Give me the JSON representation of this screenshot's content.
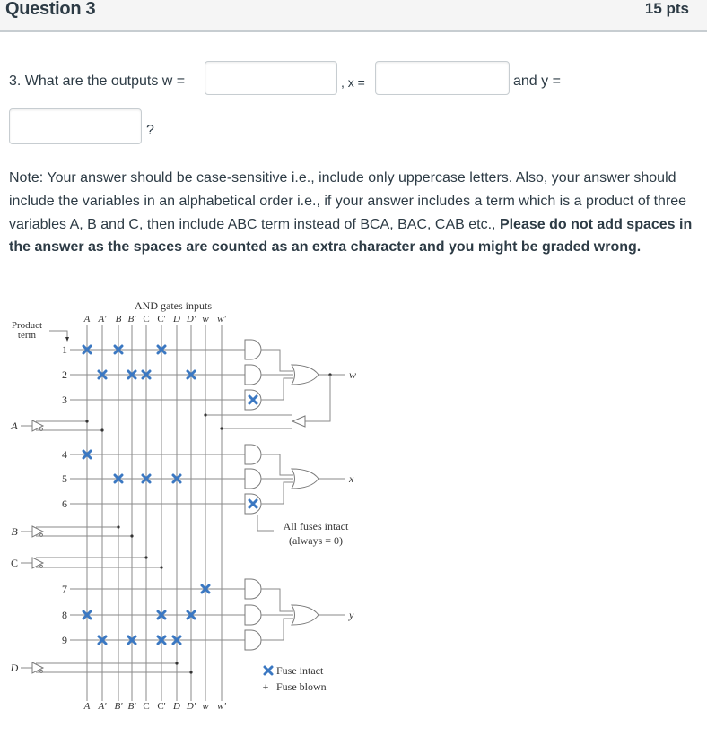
{
  "header": {
    "title": "Question 3",
    "points": "15 pts"
  },
  "question": {
    "prefix": "3. What are the outputs w =",
    "x_label": ", x =",
    "y_label": "and y =",
    "suffix": "?",
    "inputs": {
      "w": {
        "value": "",
        "placeholder": ""
      },
      "x": {
        "value": "",
        "placeholder": ""
      },
      "y": {
        "value": "",
        "placeholder": ""
      }
    }
  },
  "note": {
    "normal": "Note: Your answer should be case-sensitive i.e., include only uppercase letters. Also, your answer should include the variables in an alphabetical order i.e., if your answer includes a term which is a product of three variables A, B and C, then include ABC term instead of BCA, BAC, CAB etc., ",
    "bold": "Please do not add spaces in the answer as the spaces are counted as an extra character and you might be graded wrong."
  },
  "diagram": {
    "title": "AND gates inputs",
    "product_term_label": [
      "Product",
      "term"
    ],
    "top_columns": [
      "A",
      "A'",
      "B",
      "B'",
      "C",
      "C'",
      "D",
      "D'",
      "w",
      "w'"
    ],
    "bottom_columns": [
      "A",
      "A'",
      "B'",
      "B'",
      "C",
      "C'",
      "D",
      "D'",
      "w",
      "w'"
    ],
    "rows": [
      "1",
      "2",
      "3",
      "4",
      "5",
      "6",
      "7",
      "8",
      "9"
    ],
    "inputs": [
      "A",
      "B",
      "C",
      "D"
    ],
    "outputs": [
      "w",
      "x",
      "y"
    ],
    "fuses": {
      "1": [
        "A",
        "B",
        "C'"
      ],
      "2": [
        "A'",
        "B'",
        "C",
        "D'"
      ],
      "3": [],
      "4": [
        "A"
      ],
      "5": [
        "B",
        "C",
        "D"
      ],
      "6": [],
      "7": [
        "w"
      ],
      "8": [
        "A",
        "C'",
        "D'"
      ],
      "9": [
        "A'",
        "B'",
        "C'",
        "D"
      ]
    },
    "gate_fuse_marks": [
      "3",
      "6"
    ],
    "annotation": [
      "All fuses intact",
      "(always = 0)"
    ],
    "legend": {
      "intact": "Fuse intact",
      "blown": "Fuse blown",
      "blown_symbol": "+"
    },
    "colors": {
      "fuse": "#3b78c2",
      "line": "#888888",
      "text": "#333333"
    }
  }
}
